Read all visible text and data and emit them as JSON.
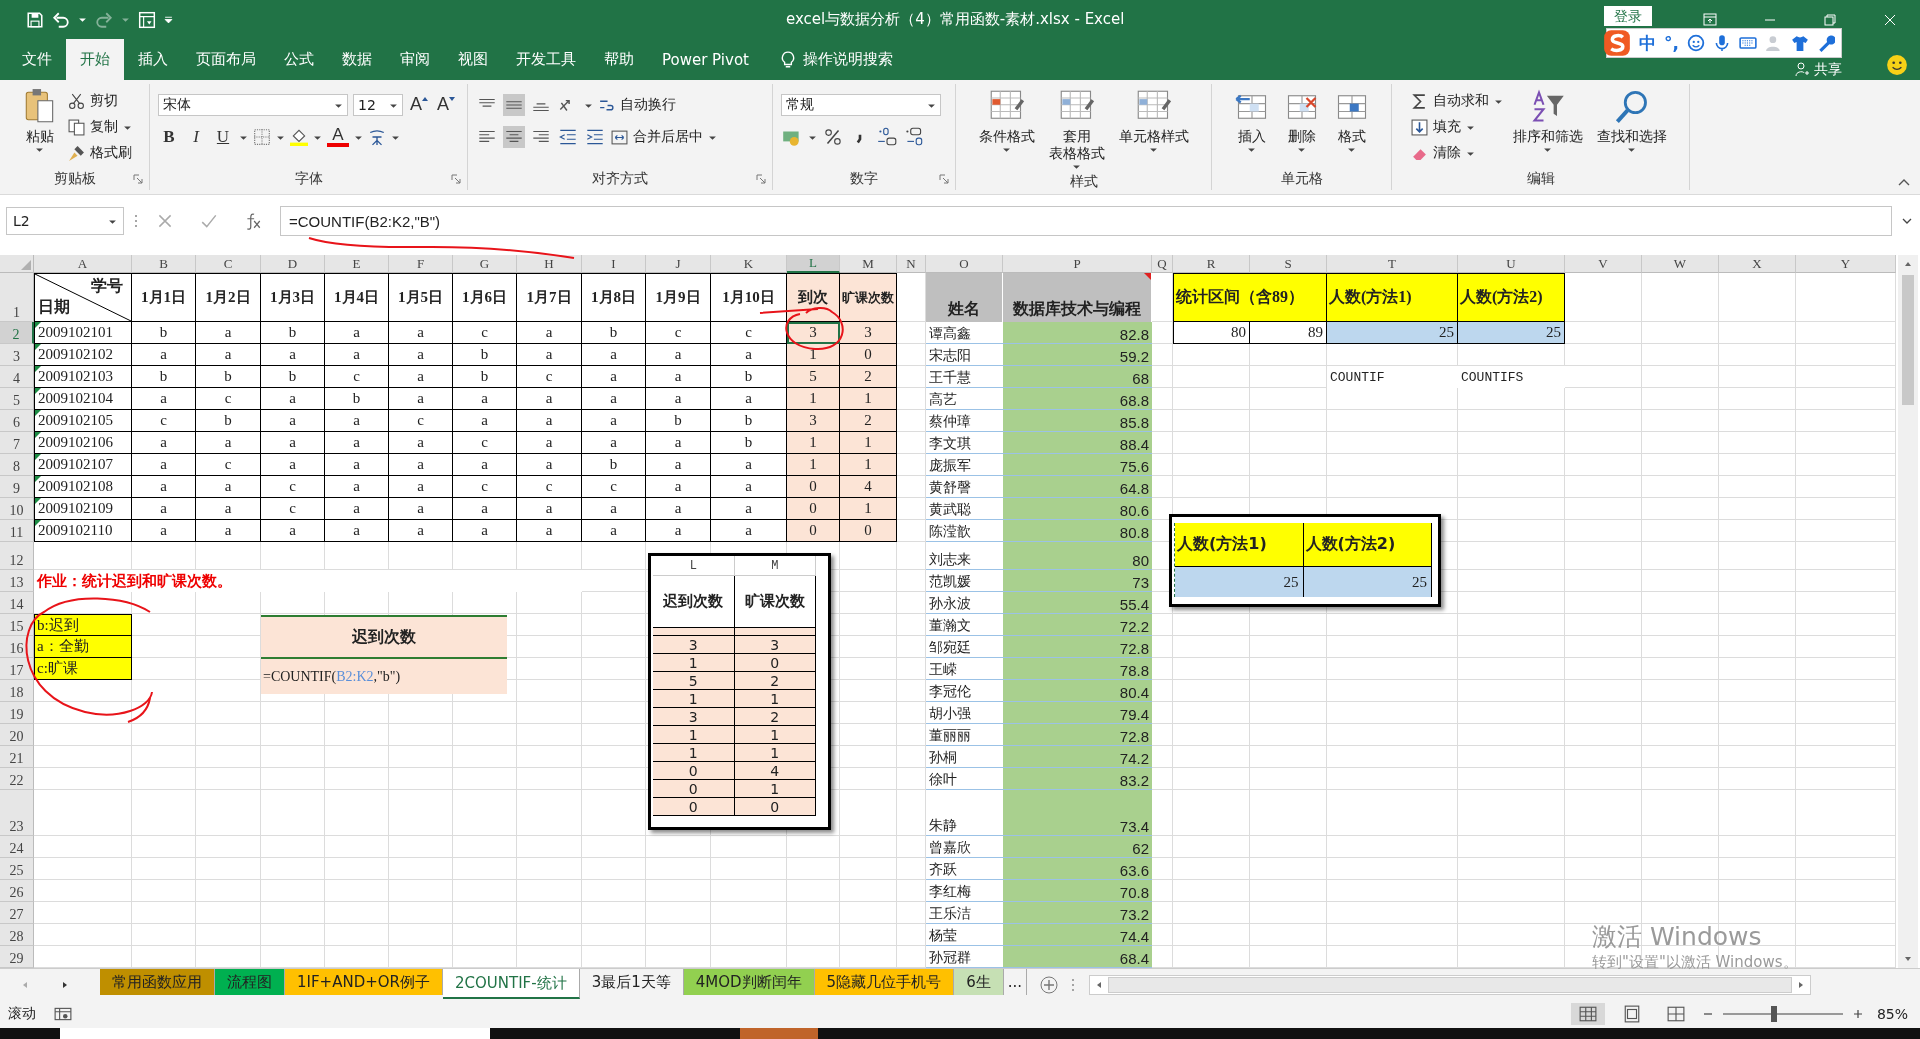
{
  "title_bar": {
    "title": "excel与数据分析（4）常用函数-素材.xlsx  -  Excel",
    "sign_in": "登录",
    "share": "共享"
  },
  "ime_bar": {
    "mode": "中",
    "punct": "°,"
  },
  "menu_tabs": [
    {
      "label": "文件",
      "selected": false
    },
    {
      "label": "开始",
      "selected": true
    },
    {
      "label": "插入",
      "selected": false
    },
    {
      "label": "页面布局",
      "selected": false
    },
    {
      "label": "公式",
      "selected": false
    },
    {
      "label": "数据",
      "selected": false
    },
    {
      "label": "审阅",
      "selected": false
    },
    {
      "label": "视图",
      "selected": false
    },
    {
      "label": "开发工具",
      "selected": false
    },
    {
      "label": "帮助",
      "selected": false
    },
    {
      "label": "Power Pivot",
      "selected": false
    }
  ],
  "tell_me": "操作说明搜索",
  "ribbon": {
    "clipboard": {
      "title": "剪贴板",
      "paste": "粘贴",
      "cut": "剪切",
      "copy": "复制",
      "painter": "格式刷"
    },
    "font": {
      "title": "字体",
      "family": "宋体",
      "size": "12",
      "grow": "A",
      "shrink": "A",
      "bold": "B",
      "italic": "I",
      "underline": "U",
      "color_letter": "A"
    },
    "align": {
      "title": "对齐方式",
      "wrap": "自动换行",
      "merge": "合并后居中"
    },
    "number": {
      "title": "数字",
      "format": "常规"
    },
    "styles": {
      "title": "样式",
      "buttons": [
        [
          "条件格式"
        ],
        [
          "套用",
          "表格格式"
        ],
        [
          "单元格样式"
        ]
      ]
    },
    "cells": {
      "title": "单元格",
      "buttons": [
        "插入",
        "删除",
        "格式"
      ]
    },
    "editing": {
      "title": "编辑",
      "autosum": "自动求和",
      "fill": "填充",
      "clear": "清除",
      "sort": "排序和筛选",
      "find": "查找和选择"
    }
  },
  "formula_bar": {
    "name_box": "L2",
    "formula": "=COUNTIF(B2:K2,\"B\")"
  },
  "sheet": {
    "columns": [
      {
        "label": "A",
        "selected": false
      },
      {
        "label": "B",
        "selected": false
      },
      {
        "label": "C",
        "selected": false
      },
      {
        "label": "D",
        "selected": false
      },
      {
        "label": "E",
        "selected": false
      },
      {
        "label": "F",
        "selected": false
      },
      {
        "label": "G",
        "selected": false
      },
      {
        "label": "H",
        "selected": false
      },
      {
        "label": "I",
        "selected": false
      },
      {
        "label": "J",
        "selected": false
      },
      {
        "label": "K",
        "selected": false
      },
      {
        "label": "L",
        "selected": true
      },
      {
        "label": "M",
        "selected": false
      },
      {
        "label": "N",
        "selected": false
      },
      {
        "label": "O",
        "selected": false
      },
      {
        "label": "P",
        "selected": false
      },
      {
        "label": "Q",
        "selected": false
      },
      {
        "label": "R",
        "selected": false
      },
      {
        "label": "S",
        "selected": false
      },
      {
        "label": "T",
        "selected": false
      },
      {
        "label": "U",
        "selected": false
      },
      {
        "label": "V",
        "selected": false
      },
      {
        "label": "W",
        "selected": false
      },
      {
        "label": "X",
        "selected": false
      },
      {
        "label": "Y",
        "selected": false
      }
    ],
    "row_headers": [
      {
        "label": "1",
        "selected": false
      },
      {
        "label": "2",
        "selected": true
      },
      {
        "label": "3",
        "selected": false
      },
      {
        "label": "4",
        "selected": false
      },
      {
        "label": "5",
        "selected": false
      },
      {
        "label": "6",
        "selected": false
      },
      {
        "label": "7",
        "selected": false
      },
      {
        "label": "8",
        "selected": false
      },
      {
        "label": "9",
        "selected": false
      },
      {
        "label": "10",
        "selected": false
      },
      {
        "label": "11",
        "selected": false
      },
      {
        "label": "12",
        "selected": false
      },
      {
        "label": "13",
        "selected": false
      },
      {
        "label": "14",
        "selected": false
      },
      {
        "label": "15",
        "selected": false
      },
      {
        "label": "16",
        "selected": false
      },
      {
        "label": "17",
        "selected": false
      },
      {
        "label": "18",
        "selected": false
      },
      {
        "label": "19",
        "selected": false
      },
      {
        "label": "20",
        "selected": false
      },
      {
        "label": "21",
        "selected": false
      },
      {
        "label": "22",
        "selected": false
      },
      {
        "label": "23",
        "selected": false
      },
      {
        "label": "24",
        "selected": false
      },
      {
        "label": "25",
        "selected": false
      },
      {
        "label": "26",
        "selected": false
      },
      {
        "label": "27",
        "selected": false
      },
      {
        "label": "28",
        "selected": false
      },
      {
        "label": "29",
        "selected": false
      }
    ]
  },
  "attendance": {
    "corner_top": "学号",
    "corner_bottom": "日期",
    "text_number_flags": true,
    "dates": [
      "1月1日",
      "1月2日",
      "1月3日",
      "1月4日",
      "1月5日",
      "1月6日",
      "1月7日",
      "1月8日",
      "1月9日",
      "1月10日"
    ],
    "late_header": "到次",
    "absent_header": "旷课次数",
    "rows": [
      {
        "id": "2009102101",
        "marks": [
          "b",
          "a",
          "b",
          "a",
          "a",
          "c",
          "a",
          "b",
          "c",
          "c"
        ],
        "late": "3",
        "absent": "3",
        "late_selected": true
      },
      {
        "id": "2009102102",
        "marks": [
          "a",
          "a",
          "a",
          "a",
          "a",
          "b",
          "a",
          "a",
          "a",
          "a"
        ],
        "late": "1",
        "absent": "0",
        "late_selected": false
      },
      {
        "id": "2009102103",
        "marks": [
          "b",
          "b",
          "b",
          "c",
          "a",
          "b",
          "c",
          "a",
          "a",
          "b"
        ],
        "late": "5",
        "absent": "2",
        "late_selected": false
      },
      {
        "id": "2009102104",
        "marks": [
          "a",
          "c",
          "a",
          "b",
          "a",
          "a",
          "a",
          "a",
          "a",
          "a"
        ],
        "late": "1",
        "absent": "1",
        "late_selected": false
      },
      {
        "id": "2009102105",
        "marks": [
          "c",
          "b",
          "a",
          "a",
          "c",
          "a",
          "a",
          "a",
          "b",
          "b"
        ],
        "late": "3",
        "absent": "2",
        "late_selected": false
      },
      {
        "id": "2009102106",
        "marks": [
          "a",
          "a",
          "a",
          "a",
          "a",
          "c",
          "a",
          "a",
          "a",
          "b"
        ],
        "late": "1",
        "absent": "1",
        "late_selected": false
      },
      {
        "id": "2009102107",
        "marks": [
          "a",
          "c",
          "a",
          "a",
          "a",
          "a",
          "a",
          "b",
          "a",
          "a"
        ],
        "late": "1",
        "absent": "1",
        "late_selected": false
      },
      {
        "id": "2009102108",
        "marks": [
          "a",
          "a",
          "c",
          "a",
          "a",
          "c",
          "c",
          "c",
          "a",
          "a"
        ],
        "late": "0",
        "absent": "4",
        "late_selected": false
      },
      {
        "id": "2009102109",
        "marks": [
          "a",
          "a",
          "c",
          "a",
          "a",
          "a",
          "a",
          "a",
          "a",
          "a"
        ],
        "late": "0",
        "absent": "1",
        "late_selected": false
      },
      {
        "id": "2009102110",
        "marks": [
          "a",
          "a",
          "a",
          "a",
          "a",
          "a",
          "a",
          "a",
          "a",
          "a"
        ],
        "late": "0",
        "absent": "0",
        "late_selected": false
      }
    ]
  },
  "homework": "作业：统计迟到和旷课次数。",
  "legend": [
    "b:迟到",
    "a：全勤",
    "c:旷课"
  ],
  "scores": {
    "name_header": "姓名",
    "score_header": "数据库技术与编程",
    "has_comment": true,
    "rows": [
      {
        "name": "谭高鑫",
        "score": "82.8"
      },
      {
        "name": "宋志阳",
        "score": "59.2"
      },
      {
        "name": "王千慧",
        "score": "68"
      },
      {
        "name": "高艺",
        "score": "68.8"
      },
      {
        "name": "蔡仲璋",
        "score": "85.8"
      },
      {
        "name": "李文琪",
        "score": "88.4"
      },
      {
        "name": "庞振军",
        "score": "75.6"
      },
      {
        "name": "黄舒謦",
        "score": "64.8"
      },
      {
        "name": "黄武聪",
        "score": "80.6"
      },
      {
        "name": "陈滢歆",
        "score": "80.8"
      },
      {
        "name": "刘志来",
        "score": "80"
      },
      {
        "name": "范凯媛",
        "score": "73"
      },
      {
        "name": "孙永波",
        "score": "55.4"
      },
      {
        "name": "董瀚文",
        "score": "72.2"
      },
      {
        "name": "邹宛廷",
        "score": "72.8"
      },
      {
        "name": "王嵘",
        "score": "78.8"
      },
      {
        "name": "李冠伦",
        "score": "80.4"
      },
      {
        "name": "胡小强",
        "score": "79.4"
      },
      {
        "name": "董丽丽",
        "score": "72.8"
      },
      {
        "name": "孙桐",
        "score": "74.2"
      },
      {
        "name": "徐叶",
        "score": "83.2"
      },
      {
        "name": "朱静",
        "score": "73.4"
      },
      {
        "name": "曾嘉欣",
        "score": "62"
      },
      {
        "name": "齐跃",
        "score": "63.6"
      },
      {
        "name": "李红梅",
        "score": "70.8"
      },
      {
        "name": "王乐洁",
        "score": "73.2"
      },
      {
        "name": "杨莹",
        "score": "74.4"
      },
      {
        "name": "孙冠群",
        "score": "68.4"
      }
    ]
  },
  "stats": {
    "range_header": "统计区间（含89）",
    "method1_header": "人数(方法1)",
    "method2_header": "人数(方法2)",
    "low": "80",
    "high": "89",
    "method1": "25",
    "method2": "25",
    "method1_note": "COUNTIF",
    "method2_note": "COUNTIFS"
  },
  "formula_picture": {
    "header": "迟到次数",
    "formula_prefix": "=COUNTIF(",
    "formula_ref": "B2:K2",
    "formula_suffix": ",\"b\")"
  },
  "table_picture": {
    "columns": [
      "L",
      "M"
    ],
    "headers": [
      "迟到次数",
      "旷课次数"
    ],
    "rows": [
      [
        "3",
        "3"
      ],
      [
        "1",
        "0"
      ],
      [
        "5",
        "2"
      ],
      [
        "1",
        "1"
      ],
      [
        "3",
        "2"
      ],
      [
        "1",
        "1"
      ],
      [
        "1",
        "1"
      ],
      [
        "0",
        "4"
      ],
      [
        "0",
        "1"
      ],
      [
        "0",
        "0"
      ]
    ]
  },
  "count_picture": {
    "headers": [
      "人数(方法1)",
      "人数(方法2)"
    ],
    "values": [
      "25",
      "25"
    ]
  },
  "sheet_tabs": [
    {
      "label": "常用函数应用",
      "selected": false,
      "color": "#bf8f00"
    },
    {
      "label": "流程图",
      "selected": false,
      "color": "#00b050"
    },
    {
      "label": "1IF+AND+OR例子",
      "selected": false,
      "color": "#ffc000"
    },
    {
      "label": "2COUNTIF-统计",
      "selected": true
    },
    {
      "label": "3最后1天等",
      "selected": false
    },
    {
      "label": "4MOD判断闰年",
      "selected": false,
      "color": "#92d050"
    },
    {
      "label": "5隐藏几位手机号",
      "selected": false,
      "color": "#ffc000"
    },
    {
      "label": "6生",
      "selected": false,
      "color": "#c6e0b4"
    }
  ],
  "more_tabs": "...",
  "status_bar": {
    "mode": "滚动",
    "zoom": "85%",
    "zoom_level": {
      "level": 0.43
    }
  },
  "activation": {
    "title": "激活 Windows",
    "hint": "转到\"设置\"以激活 Windows。"
  }
}
